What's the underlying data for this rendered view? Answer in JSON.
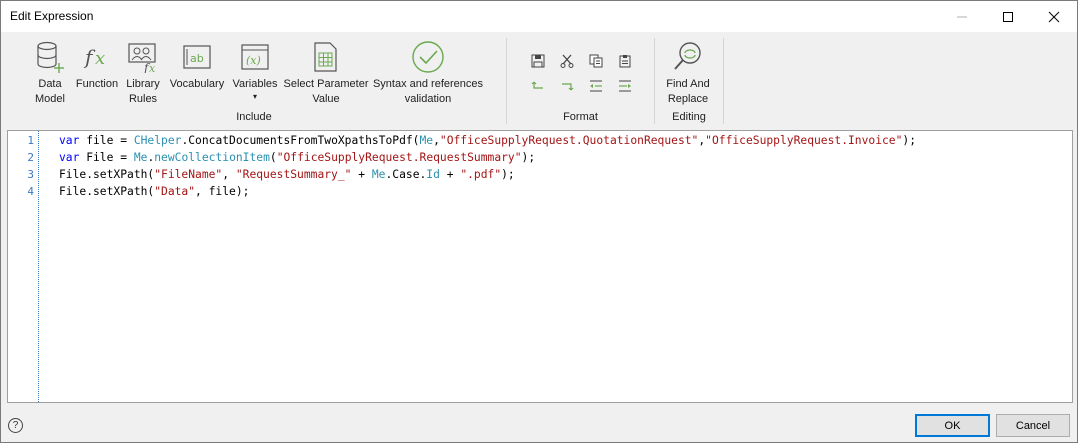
{
  "window": {
    "title": "Edit Expression",
    "minimize_icon": "minimize-icon",
    "maximize_icon": "maximize-icon",
    "close_icon": "close-icon"
  },
  "ribbon": {
    "include": {
      "label": "Include",
      "buttons": [
        {
          "line1": "Data",
          "line2": "Model",
          "icon": "data-model-icon"
        },
        {
          "line1": "Function",
          "line2": "",
          "icon": "function-icon"
        },
        {
          "line1": "Library",
          "line2": "Rules",
          "icon": "library-rules-icon"
        },
        {
          "line1": "Vocabulary",
          "line2": "",
          "icon": "vocabulary-icon"
        },
        {
          "line1": "Variables",
          "line2": "▾",
          "icon": "variables-icon"
        },
        {
          "line1": "Select Parameter",
          "line2": "Value",
          "icon": "select-parameter-icon"
        },
        {
          "line1": "Syntax and references",
          "line2": "validation",
          "icon": "validation-check-icon"
        }
      ]
    },
    "format": {
      "label": "Format",
      "tools": [
        "save-icon",
        "cut-icon",
        "copy-icon",
        "paste-icon",
        "undo-icon",
        "redo-icon",
        "outdent-icon",
        "indent-icon"
      ]
    },
    "editing": {
      "label": "Editing",
      "find_line1": "Find And",
      "find_line2": "Replace"
    },
    "accent_color": "#6aa84f"
  },
  "editor": {
    "line_numbers": [
      "1",
      "2",
      "3",
      "4"
    ],
    "lines": [
      [
        {
          "t": "var",
          "c": "kw"
        },
        {
          "t": " file = ",
          "c": ""
        },
        {
          "t": "CHelper",
          "c": "cls"
        },
        {
          "t": ".ConcatDocumentsFromTwoXpathsToPdf(",
          "c": ""
        },
        {
          "t": "Me",
          "c": "cls"
        },
        {
          "t": ",",
          "c": ""
        },
        {
          "t": "\"OfficeSupplyRequest.QuotationRequest\"",
          "c": "str"
        },
        {
          "t": ",",
          "c": ""
        },
        {
          "t": "\"OfficeSupplyRequest.Invoice\"",
          "c": "str"
        },
        {
          "t": ");",
          "c": ""
        }
      ],
      [
        {
          "t": "var",
          "c": "kw"
        },
        {
          "t": " File = ",
          "c": ""
        },
        {
          "t": "Me",
          "c": "cls"
        },
        {
          "t": ".",
          "c": ""
        },
        {
          "t": "newCollectionItem",
          "c": "cls"
        },
        {
          "t": "(",
          "c": ""
        },
        {
          "t": "\"OfficeSupplyRequest.RequestSummary\"",
          "c": "str"
        },
        {
          "t": ");",
          "c": ""
        }
      ],
      [
        {
          "t": "File.setXPath(",
          "c": ""
        },
        {
          "t": "\"FileName\"",
          "c": "str"
        },
        {
          "t": ", ",
          "c": ""
        },
        {
          "t": "\"RequestSummary_\"",
          "c": "str"
        },
        {
          "t": " + ",
          "c": ""
        },
        {
          "t": "Me",
          "c": "cls"
        },
        {
          "t": ".Case.",
          "c": ""
        },
        {
          "t": "Id",
          "c": "cls"
        },
        {
          "t": " + ",
          "c": ""
        },
        {
          "t": "\".pdf\"",
          "c": "str"
        },
        {
          "t": ");",
          "c": ""
        }
      ],
      [
        {
          "t": "File.setXPath(",
          "c": ""
        },
        {
          "t": "\"Data\"",
          "c": "str"
        },
        {
          "t": ", file);",
          "c": ""
        }
      ]
    ]
  },
  "footer": {
    "help": "?",
    "ok": "OK",
    "cancel": "Cancel"
  }
}
